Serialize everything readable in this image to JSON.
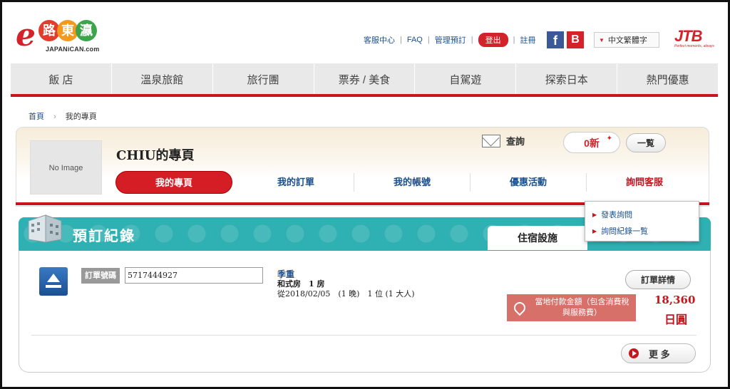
{
  "header": {
    "logo_chars": [
      "路",
      "東",
      "瀛"
    ],
    "logo_sub": "JAPANiCAN.com",
    "links": [
      "客服中心",
      "FAQ",
      "管理預訂"
    ],
    "logout": "登出",
    "register": "註冊",
    "language": "中文繁體字",
    "jtb_logo": "JTB",
    "jtb_tagline": "Perfect moments, always"
  },
  "nav": [
    "飯 店",
    "溫泉旅館",
    "旅行團",
    "票券 / 美食",
    "自駕遊",
    "探索日本",
    "熱門優惠"
  ],
  "breadcrumb": {
    "home": "首頁",
    "current": "我的專頁"
  },
  "mypage": {
    "no_image": "No Image",
    "title": "CHIU的專頁",
    "inquiry": "查詢",
    "new_count": "0新",
    "list_button": "一覧",
    "tabs": [
      "我的專頁",
      "我的訂單",
      "我的帳號",
      "優惠活動",
      "詢問客服"
    ],
    "dropdown": [
      "發表詢問",
      "詢問紀錄一覧"
    ]
  },
  "records": {
    "title": "預訂紀錄",
    "active_tab": "住宿設施",
    "order_label": "訂單號碼",
    "order_number": "5717444927",
    "hotel_name": "季重",
    "room": "和式房　1 房",
    "dates": "從2018/02/05　(1 晚)　1 位 (1 大人)",
    "detail_button": "訂單詳情",
    "pay_label": "當地付款金額（包含消費稅與服務費）",
    "price": "18,360",
    "currency": "日圓",
    "more_button": "更 多"
  },
  "colors": {
    "brand_red": "#c8151d",
    "teal": "#2fb0b2",
    "link_blue": "#1a4f8c"
  }
}
